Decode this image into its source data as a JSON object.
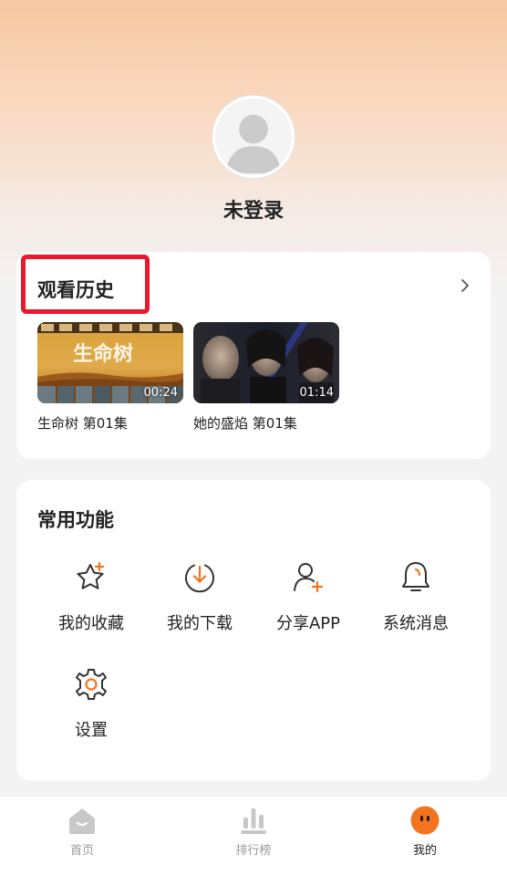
{
  "profile": {
    "status": "未登录"
  },
  "history": {
    "title": "观看历史",
    "items": [
      {
        "title": "生命树 第01集",
        "duration": "00:24",
        "poster_text": "生命树"
      },
      {
        "title": "她的盛焰 第01集",
        "duration": "01:14"
      }
    ]
  },
  "functions": {
    "title": "常用功能",
    "items": [
      {
        "label": "我的收藏",
        "icon": "star-plus-icon"
      },
      {
        "label": "我的下载",
        "icon": "download-icon"
      },
      {
        "label": "分享APP",
        "icon": "share-user-icon"
      },
      {
        "label": "系统消息",
        "icon": "bell-icon"
      },
      {
        "label": "设置",
        "icon": "gear-icon"
      }
    ]
  },
  "nav": {
    "items": [
      {
        "label": "首页",
        "icon": "home-icon",
        "active": false
      },
      {
        "label": "排行榜",
        "icon": "ranking-icon",
        "active": false
      },
      {
        "label": "我的",
        "icon": "profile-face-icon",
        "active": true
      }
    ]
  },
  "colors": {
    "accent": "#f4731f",
    "highlight_border": "#e8192c",
    "inactive_icon": "#c8c8c8"
  }
}
